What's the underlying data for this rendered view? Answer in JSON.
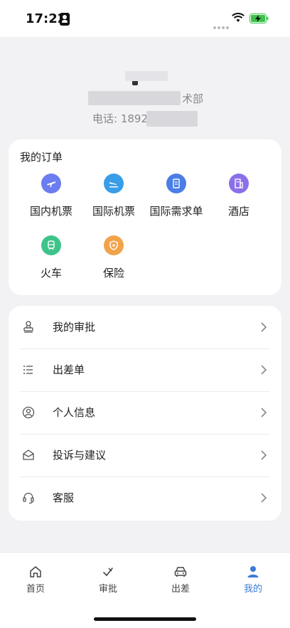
{
  "status_bar": {
    "time": "17:22"
  },
  "profile": {
    "dept_suffix": "术部",
    "phone": "电话: 1892"
  },
  "orders": {
    "title": "我的订单",
    "items": [
      {
        "label": "国内机票",
        "icon": "plane-icon",
        "color": "#6b7df0"
      },
      {
        "label": "国际机票",
        "icon": "plane-landing-icon",
        "color": "#3a9de8"
      },
      {
        "label": "国际需求单",
        "icon": "document-icon",
        "color": "#4a7ee6"
      },
      {
        "label": "酒店",
        "icon": "hotel-icon",
        "color": "#8b6fe8"
      },
      {
        "label": "火车",
        "icon": "train-icon",
        "color": "#3ec48a"
      },
      {
        "label": "保险",
        "icon": "shield-plus-icon",
        "color": "#f2a34a"
      }
    ]
  },
  "menu": {
    "items": [
      {
        "label": "我的审批",
        "icon": "stamp-icon"
      },
      {
        "label": "出差单",
        "icon": "list-icon"
      },
      {
        "label": "个人信息",
        "icon": "user-circle-icon"
      },
      {
        "label": "投诉与建议",
        "icon": "mail-open-icon"
      },
      {
        "label": "客服",
        "icon": "headset-icon"
      }
    ]
  },
  "tabs": {
    "items": [
      {
        "label": "首页",
        "icon": "home-icon"
      },
      {
        "label": "审批",
        "icon": "approve-icon"
      },
      {
        "label": "出差",
        "icon": "car-icon"
      },
      {
        "label": "我的",
        "icon": "person-icon"
      }
    ],
    "active_color": "#3a7bd5"
  }
}
